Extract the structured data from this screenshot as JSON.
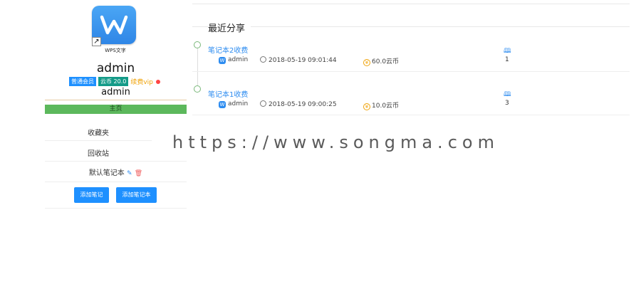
{
  "profile": {
    "logo_caption": "WPS文字",
    "username": "admin",
    "badge_member": "普通会员",
    "badge_coins": "云币 20.0",
    "renew_vip": "续费vip",
    "display_name": "admin"
  },
  "sidebar": {
    "home": "主页",
    "favorites": "收藏夹",
    "recycle": "回收站",
    "default_notebook": "默认笔记本",
    "add_note": "添加笔记",
    "add_notebook": "添加笔记本"
  },
  "main": {
    "heading": "最近分享",
    "notes": [
      {
        "title": "笔记本2收费",
        "author": "admin",
        "time": "2018-05-19 09:01:44",
        "price": "60.0云币",
        "count": "1"
      },
      {
        "title": "笔记本1收费",
        "author": "admin",
        "time": "2018-05-19 09:00:25",
        "price": "10.0云币",
        "count": "3"
      }
    ]
  },
  "watermark": "https://www.songma.com",
  "colors": {
    "accent": "#1e90ff",
    "home_bar": "#5cb85c",
    "teal_badge": "#149b88",
    "gold": "#f0a30a"
  }
}
